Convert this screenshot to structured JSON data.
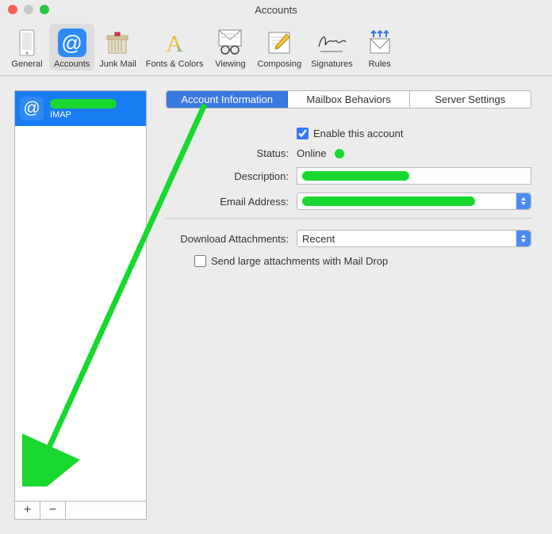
{
  "window": {
    "title": "Accounts"
  },
  "toolbar": [
    {
      "id": "general",
      "label": "General"
    },
    {
      "id": "accounts",
      "label": "Accounts",
      "selected": true
    },
    {
      "id": "junk",
      "label": "Junk Mail"
    },
    {
      "id": "fonts",
      "label": "Fonts & Colors"
    },
    {
      "id": "viewing",
      "label": "Viewing"
    },
    {
      "id": "composing",
      "label": "Composing"
    },
    {
      "id": "signatures",
      "label": "Signatures"
    },
    {
      "id": "rules",
      "label": "Rules"
    }
  ],
  "sidebar": {
    "account": {
      "type": "IMAP"
    },
    "add_label": "+",
    "remove_label": "−"
  },
  "tabs": [
    {
      "id": "info",
      "label": "Account Information",
      "active": true
    },
    {
      "id": "mailbox",
      "label": "Mailbox Behaviors"
    },
    {
      "id": "server",
      "label": "Server Settings"
    }
  ],
  "form": {
    "enable_label": "Enable this account",
    "enable_checked": true,
    "status_label": "Status:",
    "status_value": "Online",
    "description_label": "Description:",
    "email_label": "Email Address:",
    "download_label": "Download Attachments:",
    "download_value": "Recent",
    "maildrop_label": "Send large attachments with Mail Drop",
    "maildrop_checked": false
  }
}
